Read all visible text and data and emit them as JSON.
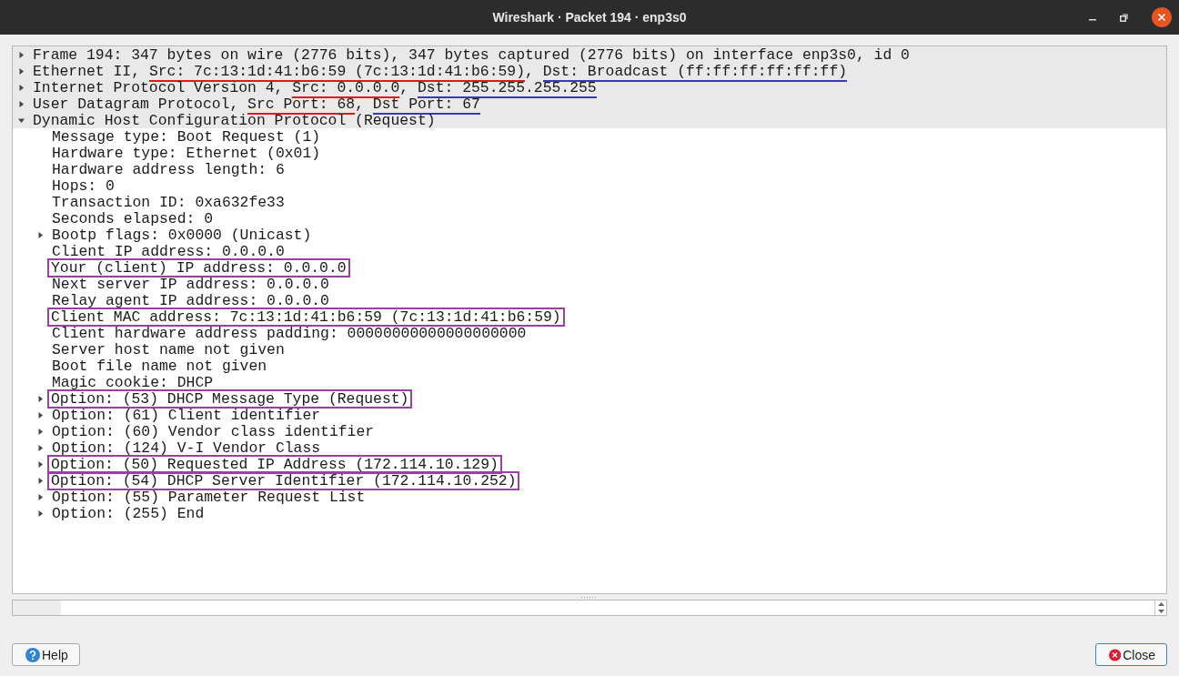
{
  "window": {
    "title": "Wireshark · Packet 194 · enp3s0"
  },
  "tree": [
    {
      "expanded": false,
      "segments": [
        {
          "text": "Frame 194: 347 bytes on wire (2776 bits), 347 bytes captured (2776 bits) on interface enp3s0, id 0"
        }
      ]
    },
    {
      "expanded": false,
      "segments": [
        {
          "text": "Ethernet II, "
        },
        {
          "text": "Src: 7c:13:1d:41:b6:59 (7c:13:1d:41:b6:59)",
          "color": "#e8141c"
        },
        {
          "text": ", "
        },
        {
          "text": "Dst: Broadcast (ff:ff:ff:ff:ff:ff)",
          "color": "#3a3ab8"
        }
      ]
    },
    {
      "expanded": false,
      "segments": [
        {
          "text": "Internet Protocol Version 4, "
        },
        {
          "text": "Src: 0.0.0.0",
          "color": "#e8141c"
        },
        {
          "text": ", "
        },
        {
          "text": "Dst: 255.255.255.255",
          "color": "#3a3ab8"
        }
      ]
    },
    {
      "expanded": false,
      "segments": [
        {
          "text": "User Datagram Protocol, "
        },
        {
          "text": "Src Port: 68",
          "color": "#e8141c"
        },
        {
          "text": ", "
        },
        {
          "text": "Dst Port: 67",
          "color": "#3a3ab8"
        }
      ]
    },
    {
      "expanded": true,
      "segments": [
        {
          "text": "Dynamic Host Configuration Protocol (Request)"
        }
      ],
      "children": [
        {
          "text": "Message type: Boot Request (1)",
          "boxed": false
        },
        {
          "text": "Hardware type: Ethernet (0x01)",
          "boxed": false
        },
        {
          "text": "Hardware address length: 6",
          "boxed": false
        },
        {
          "text": "Hops: 0",
          "boxed": false
        },
        {
          "text": "Transaction ID: 0xa632fe33",
          "boxed": false
        },
        {
          "text": "Seconds elapsed: 0",
          "boxed": false
        },
        {
          "text": "Bootp flags: 0x0000 (Unicast)",
          "boxed": false,
          "expanded": false
        },
        {
          "text": "Client IP address: 0.0.0.0",
          "boxed": false
        },
        {
          "text": "Your (client) IP address: 0.0.0.0",
          "boxed": true
        },
        {
          "text": "Next server IP address: 0.0.0.0",
          "boxed": false
        },
        {
          "text": "Relay agent IP address: 0.0.0.0",
          "boxed": false
        },
        {
          "text": "Client MAC address: 7c:13:1d:41:b6:59 (7c:13:1d:41:b6:59)",
          "boxed": true
        },
        {
          "text": "Client hardware address padding: 00000000000000000000",
          "boxed": false
        },
        {
          "text": "Server host name not given",
          "boxed": false
        },
        {
          "text": "Boot file name not given",
          "boxed": false
        },
        {
          "text": "Magic cookie: DHCP",
          "boxed": false
        },
        {
          "text": "Option: (53) DHCP Message Type (Request)",
          "boxed": true,
          "expanded": false
        },
        {
          "text": "Option: (61) Client identifier",
          "boxed": false,
          "expanded": false
        },
        {
          "text": "Option: (60) Vendor class identifier",
          "boxed": false,
          "expanded": false
        },
        {
          "text": "Option: (124) V-I Vendor Class",
          "boxed": false,
          "expanded": false
        },
        {
          "text": "Option: (50) Requested IP Address (172.114.10.129)",
          "boxed": true,
          "expanded": false
        },
        {
          "text": "Option: (54) DHCP Server Identifier (172.114.10.252)",
          "boxed": true,
          "expanded": false
        },
        {
          "text": "Option: (55) Parameter Request List",
          "boxed": false,
          "expanded": false
        },
        {
          "text": "Option: (255) End",
          "boxed": false,
          "expanded": false
        }
      ]
    }
  ],
  "buttons": {
    "help": "Help",
    "close": "Close"
  }
}
